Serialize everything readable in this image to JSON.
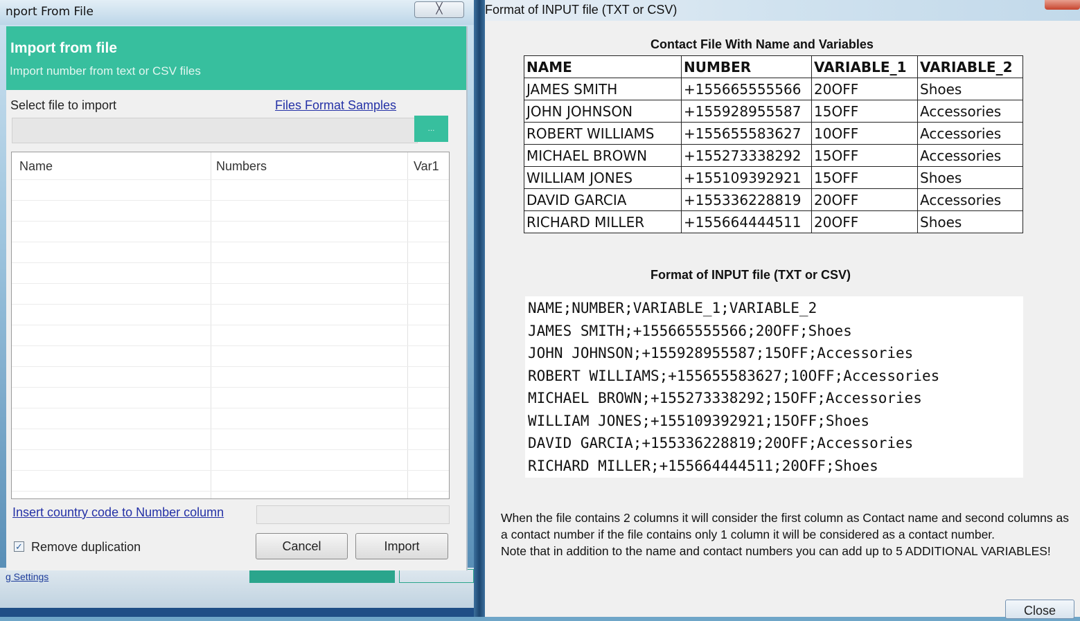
{
  "left_window": {
    "title": "nport From File",
    "close_glyph": "╳",
    "header_title": "Import from file",
    "header_subtitle": "Import number from text or CSV files",
    "select_label": "Select file to import",
    "format_link": "Files Format Samples",
    "path_value": "",
    "browse_label": "...",
    "grid": {
      "columns": [
        "Name",
        "Numbers",
        "Var1"
      ],
      "rows": []
    },
    "country_link": "Insert country code to Number column",
    "country_value": "",
    "remove_duplication": {
      "label": "Remove duplication",
      "checked": true
    },
    "cancel_label": "Cancel",
    "import_label": "Import",
    "background_link": "g Settings"
  },
  "right_window": {
    "title": "Format of INPUT file (TXT or CSV)",
    "table_title": "Contact File With Name and Variables",
    "table": {
      "headers": [
        "NAME",
        "NUMBER",
        "VARIABLE_1",
        "VARIABLE_2"
      ],
      "rows": [
        [
          "JAMES SMITH",
          "+155665555566",
          "20OFF",
          "Shoes"
        ],
        [
          "JOHN JOHNSON",
          "+155928955587",
          "15OFF",
          "Accessories"
        ],
        [
          "ROBERT WILLIAMS",
          "+155655583627",
          "10OFF",
          "Accessories"
        ],
        [
          "MICHAEL BROWN",
          "+155273338292",
          "15OFF",
          "Accessories"
        ],
        [
          "WILLIAM JONES",
          "+155109392921",
          "15OFF",
          "Shoes"
        ],
        [
          "DAVID GARCIA",
          "+155336228819",
          "20OFF",
          "Accessories"
        ],
        [
          "RICHARD MILLER",
          "+155664444511",
          "20OFF",
          "Shoes"
        ]
      ]
    },
    "format_title": "Format of INPUT file (TXT or CSV)",
    "code_lines": [
      "NAME;NUMBER;VARIABLE_1;VARIABLE_2",
      "JAMES SMITH;+155665555566;20OFF;Shoes",
      "JOHN JOHNSON;+155928955587;15OFF;Accessories",
      "ROBERT WILLIAMS;+155655583627;10OFF;Accessories",
      "MICHAEL BROWN;+155273338292;15OFF;Accessories",
      "WILLIAM JONES;+155109392921;15OFF;Shoes",
      "DAVID GARCIA;+155336228819;20OFF;Accessories",
      "RICHARD MILLER;+155664444511;20OFF;Shoes"
    ],
    "note_line1": "When the file contains 2 columns it will consider the first column as Contact name and second columns as a contact number if the file contains only 1 column it will be considered as a contact number.",
    "note_line2": "Note that in addition to the name and contact numbers you can  add up to 5 ADDITIONAL VARIABLES!",
    "close_label": "Close"
  },
  "colors": {
    "accent": "#37bf9e",
    "link": "#2431a6"
  }
}
